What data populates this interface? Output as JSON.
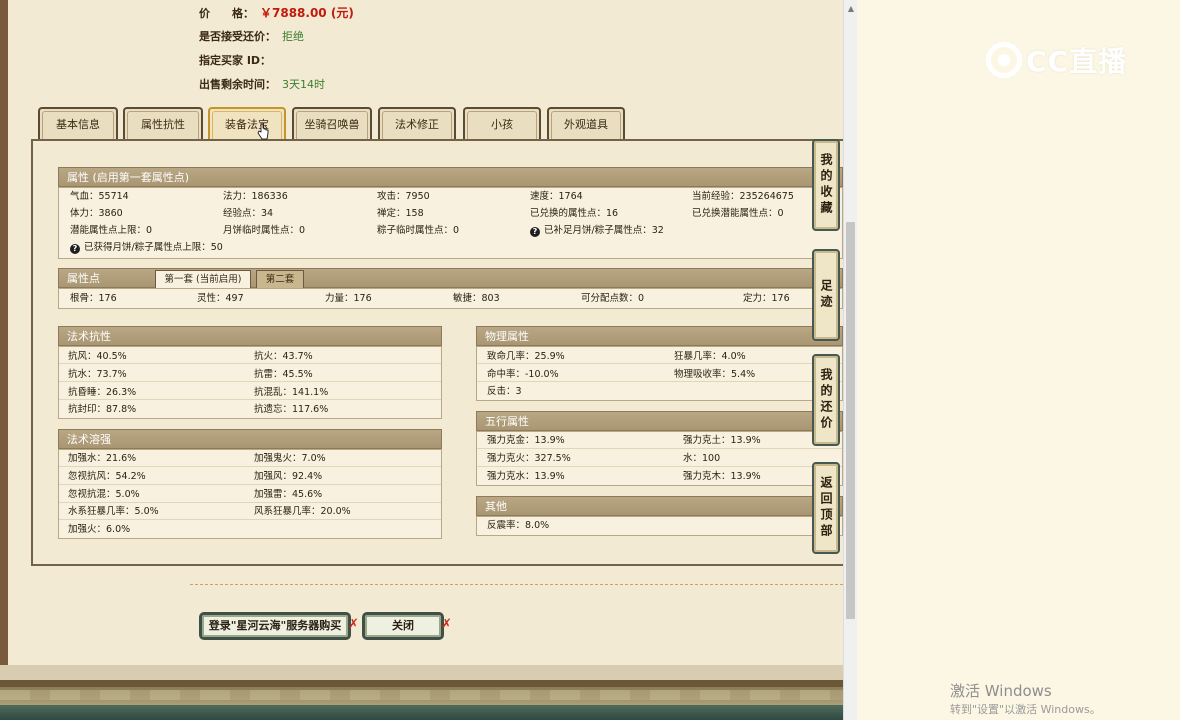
{
  "header": {
    "price_label": "价　　格：",
    "price_value": "￥7888.00 (元)",
    "bargain_label": "是否接受还价：",
    "bargain_value": "拒绝",
    "buyer_label": "指定买家 ID：",
    "remaining_label": "出售剩余时间：",
    "remaining_value": "3天14时"
  },
  "tabs": [
    "基本信息",
    "属性抗性",
    "装备法宝",
    "坐骑召唤兽",
    "法术修正",
    "小孩",
    "外观道具"
  ],
  "active_tab": "装备法宝",
  "attr_section": {
    "title": "属性 (启用第一套属性点)",
    "rows": [
      [
        "气血：55714",
        "法力：186336",
        "攻击：7950",
        "速度：1764",
        "当前经验：235264675"
      ],
      [
        "体力：3860",
        "经验点：34",
        "禅定：158",
        "已兑换的属性点：16",
        "已兑换潜能属性点：0"
      ],
      [
        "潜能属性点上限：0",
        "月饼临时属性点：0",
        "粽子临时属性点：0",
        "已补足月饼/粽子属性点：32",
        ""
      ]
    ],
    "footer": "已获得月饼/粽子属性点上限：50"
  },
  "points_section": {
    "title": "属性点",
    "subtab_1": "第一套 (当前启用)",
    "subtab_2": "第二套",
    "values": [
      "根骨：176",
      "灵性：497",
      "力量：176",
      "敏捷：803",
      "可分配点数：0",
      "定力：176"
    ]
  },
  "magic_resist": {
    "title": "法术抗性",
    "rows": [
      [
        "抗风：40.5%",
        "抗火：43.7%"
      ],
      [
        "抗水：73.7%",
        "抗雷：45.5%"
      ],
      [
        "抗昏睡：26.3%",
        "抗混乱：141.1%"
      ],
      [
        "抗封印：87.8%",
        "抗遗忘：117.6%"
      ]
    ]
  },
  "magic_mastery": {
    "title": "法术溶强",
    "rows": [
      [
        "加强水：21.6%",
        "加强鬼火：7.0%"
      ],
      [
        "忽视抗风：54.2%",
        "加强风：92.4%"
      ],
      [
        "忽视抗混：5.0%",
        "加强雷：45.6%"
      ],
      [
        "水系狂暴几率：5.0%",
        "风系狂暴几率：20.0%"
      ],
      [
        "加强火：6.0%",
        ""
      ]
    ]
  },
  "physical": {
    "title": "物理属性",
    "rows": [
      [
        "致命几率：25.9%",
        "狂暴几率：4.0%"
      ],
      [
        "命中率：-10.0%",
        "物理吸收率：5.4%"
      ],
      [
        "反击：3",
        ""
      ]
    ]
  },
  "five_elements": {
    "title": "五行属性",
    "rows": [
      [
        "强力克金：13.9%",
        "强力克土：13.9%"
      ],
      [
        "强力克火：327.5%",
        "水：100"
      ],
      [
        "强力克水：13.9%",
        "强力克木：13.9%"
      ]
    ]
  },
  "other": {
    "title": "其他",
    "rows": [
      [
        "反震率：8.0%"
      ]
    ]
  },
  "side_buttons": [
    "我的收藏",
    "足迹",
    "我的还价",
    "返回顶部"
  ],
  "bottom_buttons": {
    "login_buy": "登录\"星河云海\"服务器购买",
    "close": "关闭"
  },
  "watermark": {
    "logo": "CC直播",
    "windows_title": "激活 Windows",
    "windows_sub": "转到\"设置\"以激活 Windows。"
  },
  "colors": {
    "price": "#c21a0c",
    "value_green": "#3c7d2e",
    "section_header": "#b9a785",
    "active_tab_border": "#c5942c"
  }
}
